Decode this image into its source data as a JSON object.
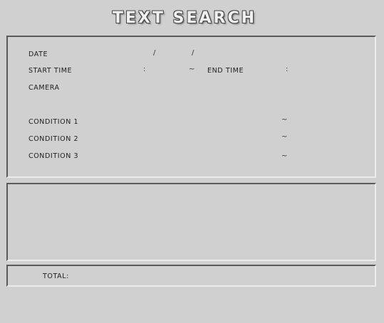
{
  "title": "TEXT SEARCH",
  "search": {
    "date_label": "DATE",
    "date_sep1": "/",
    "date_sep2": "/",
    "start_time_label": "START TIME",
    "start_time_sep": ":",
    "range_sep": "~",
    "end_time_label": "END TIME",
    "end_time_sep": ":",
    "camera_label": "CAMERA",
    "conditions": [
      {
        "label": "CONDITION 1",
        "sep": "~"
      },
      {
        "label": "CONDITION 2",
        "sep": "~"
      },
      {
        "label": "CONDITION 3",
        "sep": "~"
      }
    ]
  },
  "footer": {
    "total_label": "TOTAL:"
  },
  "colors": {
    "background": "#d0d0d0",
    "title_fill": "#f0f0f0",
    "title_outline": "#444444"
  }
}
